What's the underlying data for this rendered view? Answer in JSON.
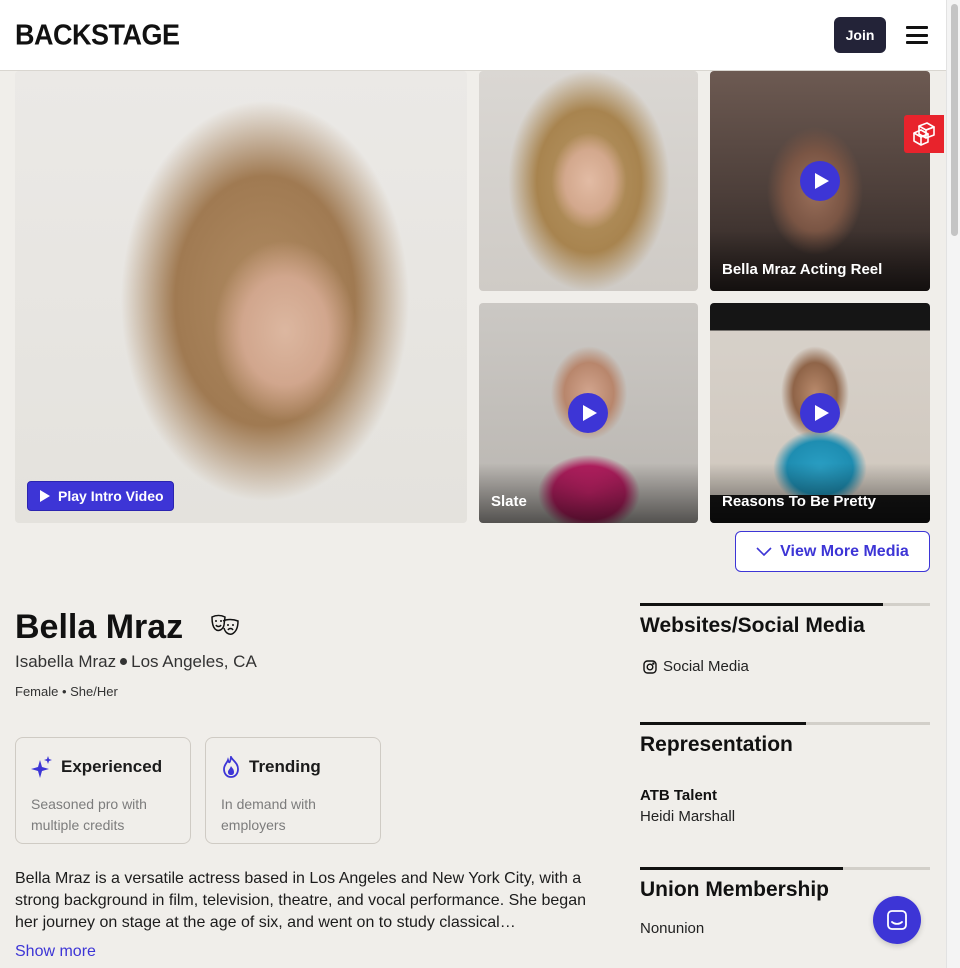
{
  "header": {
    "logo": "BACKSTAGE",
    "join_label": "Join"
  },
  "media": {
    "intro_button": "Play Intro Video",
    "videos": [
      "Bella Mraz Acting Reel",
      "Slate",
      "Reasons To Be Pretty"
    ],
    "view_more": "View More Media"
  },
  "profile": {
    "name": "Bella Mraz",
    "full_name": "Isabella Mraz",
    "location": "Los Angeles, CA",
    "gender": "Female",
    "pronouns": "She/Her",
    "badges": [
      {
        "title": "Experienced",
        "desc": "Seasoned pro with multiple credits"
      },
      {
        "title": "Trending",
        "desc": "In demand with employers"
      }
    ],
    "bio": "Bella Mraz is a versatile actress based in Los Angeles and New York City, with a strong background in film, television, theatre, and vocal performance. She began her journey on stage at the age of six, and went on to study classical…",
    "show_more": "Show more"
  },
  "side": {
    "websites_title": "Websites/Social Media",
    "social_label": "Social Media",
    "representation_title": "Representation",
    "agency": "ATB Talent",
    "agent": "Heidi Marshall",
    "union_title": "Union Membership",
    "union": "Nonunion"
  },
  "colors": {
    "accent": "#3d35d6",
    "dark_button": "#232338",
    "widget_red": "#e8232c",
    "background": "#f0eeea"
  }
}
